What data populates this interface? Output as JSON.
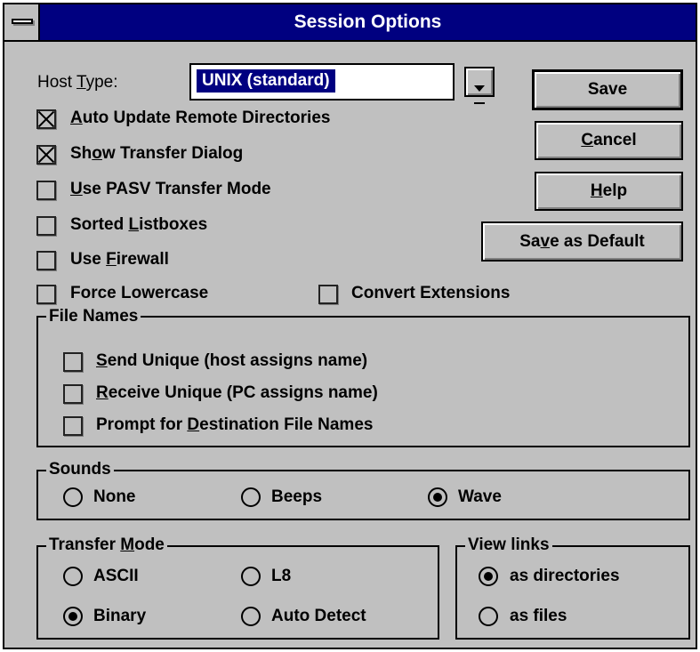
{
  "window": {
    "title": "Session Options"
  },
  "host_type": {
    "label": "Host Type:",
    "value": "UNIX (standard)"
  },
  "options": {
    "auto_update": {
      "label": "Auto Update Remote Directories",
      "checked": true
    },
    "show_transfer": {
      "label": "Show Transfer Dialog",
      "checked": true
    },
    "use_pasv": {
      "label": "Use PASV Transfer Mode",
      "checked": false
    },
    "sorted_listboxes": {
      "label": "Sorted Listboxes",
      "checked": false
    },
    "use_firewall": {
      "label": "Use Firewall",
      "checked": false
    },
    "force_lowercase": {
      "label": "Force Lowercase",
      "checked": false
    },
    "convert_extensions": {
      "label": "Convert Extensions",
      "checked": false
    }
  },
  "buttons": {
    "save": "Save",
    "cancel": "Cancel",
    "help": "Help",
    "save_default": "Save as Default"
  },
  "file_names": {
    "title": "File Names",
    "send_unique": {
      "label": "Send Unique (host assigns name)",
      "checked": false
    },
    "receive_unique": {
      "label": "Receive Unique (PC assigns name)",
      "checked": false
    },
    "prompt_dest": {
      "label": "Prompt for Destination File Names",
      "checked": false
    }
  },
  "sounds": {
    "title": "Sounds",
    "none": "None",
    "beeps": "Beeps",
    "wave": "Wave",
    "selected": "Wave"
  },
  "transfer_mode": {
    "title": "Transfer Mode",
    "ascii": "ASCII",
    "l8": "L8",
    "binary": "Binary",
    "auto_detect": "Auto Detect",
    "selected": "Binary"
  },
  "view_links": {
    "title": "View links",
    "as_directories": "as directories",
    "as_files": "as files",
    "selected": "as directories"
  }
}
